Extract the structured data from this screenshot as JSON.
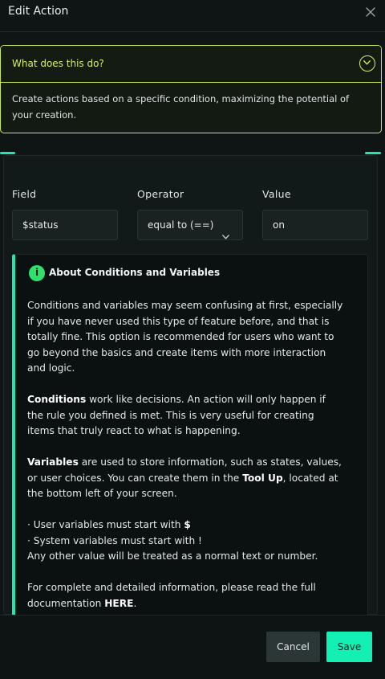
{
  "dialog": {
    "title": "Edit Action"
  },
  "help": {
    "question": "What does this do?",
    "answer": "Create actions based on a specific condition, maximizing the potential of your creation."
  },
  "form": {
    "field_label": "Field",
    "field_value": "$status",
    "operator_label": "Operator",
    "operator_value": "equal to (==)",
    "value_label": "Value",
    "value_value": "on"
  },
  "info": {
    "icon": "info-icon",
    "title": "About Conditions and Variables",
    "p1": "Conditions and variables may seem confusing at first, especially if you have never used this type of feature before, and that is totally fine. This option is recommended for users who want to go beyond the basics and create items with more interaction and logic.",
    "p2_bold": "Conditions",
    "p2_rest": " work like decisions. An action will only happen if the rule you defined is met. This is very useful for creating items that truly react to what is happening.",
    "p3_bold": "Variables",
    "p3_mid": " are used to store information, such as states, values, or user choices. You can create them in the ",
    "p3_tool": "Tool Up",
    "p3_end": ", located at the bottom left of your screen.",
    "bullet1": "· User variables must start with ",
    "bullet1_sym": "$",
    "bullet2": "· System variables must start with !",
    "line3": "Any other value will be treated as a normal text or number.",
    "p5": "For complete and detailed information, please read the full documentation ",
    "p5_link": "HERE",
    "p5_end": "."
  },
  "footer": {
    "cancel_label": "Cancel",
    "save_label": "Save"
  },
  "colors": {
    "accent": "#12f0b4",
    "help_border": "#c8e65a",
    "info_icon": "#2fe06a"
  }
}
